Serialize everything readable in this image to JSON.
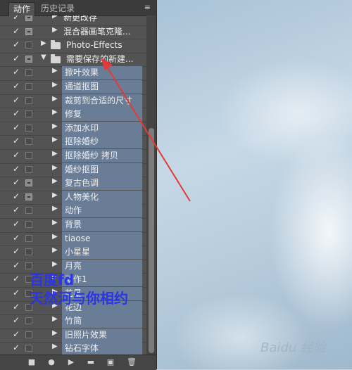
{
  "tabs": {
    "actions": "动作",
    "history": "历史记录",
    "menu_icon": "panel-menu-icon"
  },
  "rows": [
    {
      "label": "新更改存",
      "kind": "plain",
      "dlg": "on",
      "tri": "right",
      "indent": 1
    },
    {
      "label": "混合器画笔克隆...",
      "kind": "plain",
      "dlg": "on",
      "tri": "right",
      "indent": 1
    },
    {
      "label": "Photo-Effects",
      "kind": "folder",
      "dlg": "off",
      "tri": "right",
      "indent": 0
    },
    {
      "label": "需要保存的新建...",
      "kind": "folder",
      "dlg": "on",
      "tri": "down",
      "indent": 0
    },
    {
      "label": "掀叶效果",
      "kind": "hl",
      "dlg": "off",
      "tri": "right",
      "indent": 1
    },
    {
      "label": "通道抠图",
      "kind": "hl",
      "dlg": "off",
      "tri": "right",
      "indent": 1
    },
    {
      "label": "裁剪到合适的尺寸",
      "kind": "hl",
      "dlg": "off",
      "tri": "right",
      "indent": 1
    },
    {
      "label": "修复",
      "kind": "hl",
      "dlg": "off",
      "tri": "right",
      "indent": 1
    },
    {
      "label": "添加水印",
      "kind": "hl",
      "dlg": "off",
      "tri": "right",
      "indent": 1
    },
    {
      "label": "抠除婚纱",
      "kind": "hl",
      "dlg": "off",
      "tri": "right",
      "indent": 1
    },
    {
      "label": "抠除婚纱 拷贝",
      "kind": "hl",
      "dlg": "off",
      "tri": "right",
      "indent": 1
    },
    {
      "label": "婚纱抠图",
      "kind": "hl",
      "dlg": "off",
      "tri": "right",
      "indent": 1
    },
    {
      "label": "复古色调",
      "kind": "hl",
      "dlg": "on",
      "tri": "right",
      "indent": 1
    },
    {
      "label": "人物美化",
      "kind": "hl",
      "dlg": "on",
      "tri": "right",
      "indent": 1
    },
    {
      "label": "动作",
      "kind": "hl",
      "dlg": "off",
      "tri": "right",
      "indent": 1
    },
    {
      "label": "背景",
      "kind": "hl",
      "dlg": "off",
      "tri": "right",
      "indent": 1
    },
    {
      "label": "tiaose",
      "kind": "hl",
      "dlg": "off",
      "tri": "right",
      "indent": 1
    },
    {
      "label": "小星星",
      "kind": "hl",
      "dlg": "off",
      "tri": "right",
      "indent": 1
    },
    {
      "label": "月亮",
      "kind": "hl",
      "dlg": "off",
      "tri": "right",
      "indent": 1
    },
    {
      "label": "动作1",
      "kind": "hl",
      "dlg": "off",
      "tri": "right",
      "indent": 1
    },
    {
      "label": "花星",
      "kind": "hl",
      "dlg": "off",
      "tri": "right",
      "indent": 1
    },
    {
      "label": "花边",
      "kind": "hl",
      "dlg": "off",
      "tri": "right",
      "indent": 1
    },
    {
      "label": "竹简",
      "kind": "hl",
      "dlg": "off",
      "tri": "right",
      "indent": 1
    },
    {
      "label": "旧照片效果",
      "kind": "hl",
      "dlg": "off",
      "tri": "right",
      "indent": 1
    },
    {
      "label": "钻石字体",
      "kind": "hl",
      "dlg": "off",
      "tri": "right",
      "indent": 1
    }
  ],
  "check_glyph": "✓",
  "bottom_bar": [
    {
      "name": "stop-icon",
      "glyph": "■"
    },
    {
      "name": "record-icon",
      "glyph": "●"
    },
    {
      "name": "play-icon",
      "glyph": "▶"
    },
    {
      "name": "new-set-folder-icon",
      "glyph": "▬"
    },
    {
      "name": "new-action-icon",
      "glyph": "▣"
    },
    {
      "name": "delete-trash-icon",
      "glyph": "🗑"
    }
  ],
  "watermark": {
    "line1": "百度fd",
    "line2": "天然河与你相约"
  },
  "baidu_logo": "Baidu 经验",
  "annotation_arrow_color": "#e53935"
}
